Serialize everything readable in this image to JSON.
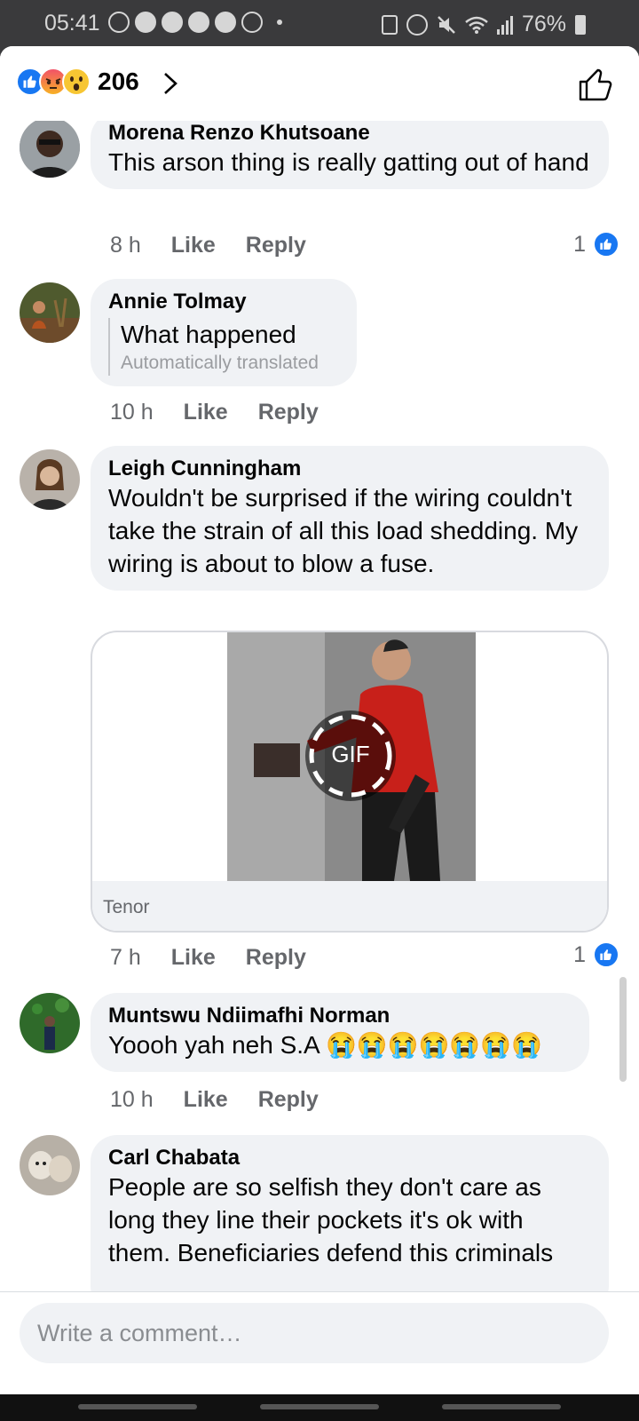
{
  "status_bar": {
    "time": "05:41",
    "battery": "76%",
    "left_icons": [
      "whatsapp-icon",
      "messenger-icon",
      "messenger-icon",
      "messenger-icon",
      "messenger-icon",
      "sync-icon"
    ],
    "right_icons": [
      "sim-icon",
      "alarm-icon",
      "mute-icon",
      "wifi-icon",
      "signal-icon",
      "battery-charging-icon"
    ]
  },
  "header": {
    "reaction_count": "206",
    "reactions": [
      "like",
      "angry",
      "wow"
    ]
  },
  "comments": [
    {
      "author": "Morena Renzo Khutsoane",
      "text": "This arson thing is really gatting out of hand",
      "time": "8 h",
      "like_label": "Like",
      "reply_label": "Reply",
      "likes": "1"
    },
    {
      "author": "Annie Tolmay",
      "text": "What happened",
      "translated_note": "Automatically translated",
      "time": "10 h",
      "like_label": "Like",
      "reply_label": "Reply"
    },
    {
      "author": "Leigh Cunningham",
      "text": "Wouldn't be surprised if the wiring couldn't take the strain of all this load shedding. My wiring is about to blow a fuse.",
      "gif_label": "GIF",
      "gif_source": "Tenor",
      "time": "7 h",
      "like_label": "Like",
      "reply_label": "Reply",
      "likes": "1"
    },
    {
      "author": "Muntswu Ndiimafhi Norman",
      "text": "Yoooh yah neh S.A 😭😭😭😭😭😭😭",
      "time": "10 h",
      "like_label": "Like",
      "reply_label": "Reply"
    },
    {
      "author": "Carl Chabata",
      "text": "People are so selfish they don't care as long they line their pockets it's ok with them. Beneficiaries defend this criminals"
    }
  ],
  "composer": {
    "placeholder": "Write a comment…"
  },
  "colors": {
    "accent": "#1877f2",
    "bubble": "#f0f2f5",
    "secondary_text": "#65676b"
  }
}
